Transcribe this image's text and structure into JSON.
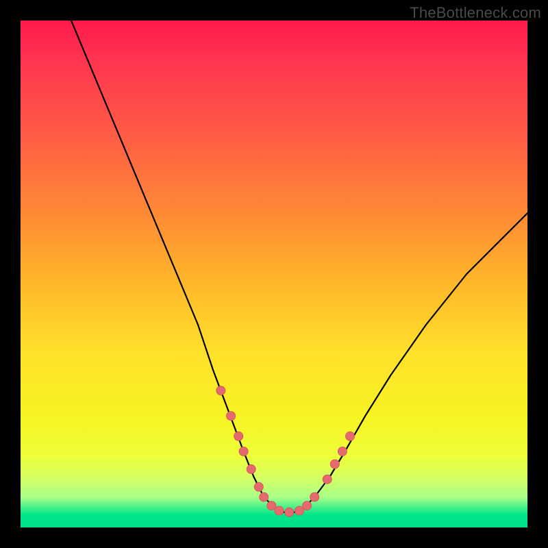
{
  "watermark": "TheBottleneck.com",
  "chart_data": {
    "type": "line",
    "title": "",
    "xlabel": "",
    "ylabel": "",
    "xlim": [
      0,
      100
    ],
    "ylim": [
      0,
      100
    ],
    "series": [
      {
        "name": "curve",
        "x": [
          10,
          15,
          20,
          25,
          30,
          35,
          38,
          41,
          44,
          46,
          48,
          50,
          52,
          54,
          56,
          58,
          61,
          64,
          68,
          73,
          80,
          88,
          96,
          100
        ],
        "values": [
          100,
          88,
          76,
          64,
          52,
          40,
          31,
          23,
          15,
          10,
          6,
          4,
          3,
          3,
          4,
          6,
          10,
          15,
          22,
          30,
          40,
          50,
          58,
          62
        ]
      }
    ],
    "markers": {
      "name": "dots",
      "x": [
        39.5,
        41.5,
        43.0,
        44.0,
        45.5,
        47.0,
        48.0,
        49.5,
        51.0,
        53.0,
        55.0,
        56.5,
        58.0,
        60.5,
        62.0,
        63.5,
        65.0
      ],
      "values": [
        27.0,
        22.0,
        18.0,
        15.0,
        11.5,
        8.0,
        6.0,
        4.3,
        3.3,
        3.0,
        3.3,
        4.3,
        6.0,
        9.5,
        12.5,
        15.0,
        18.0
      ]
    },
    "colors": {
      "curve": "#000000",
      "marker_fill": "#e56a6d",
      "marker_stroke": "#d45a5d"
    }
  }
}
